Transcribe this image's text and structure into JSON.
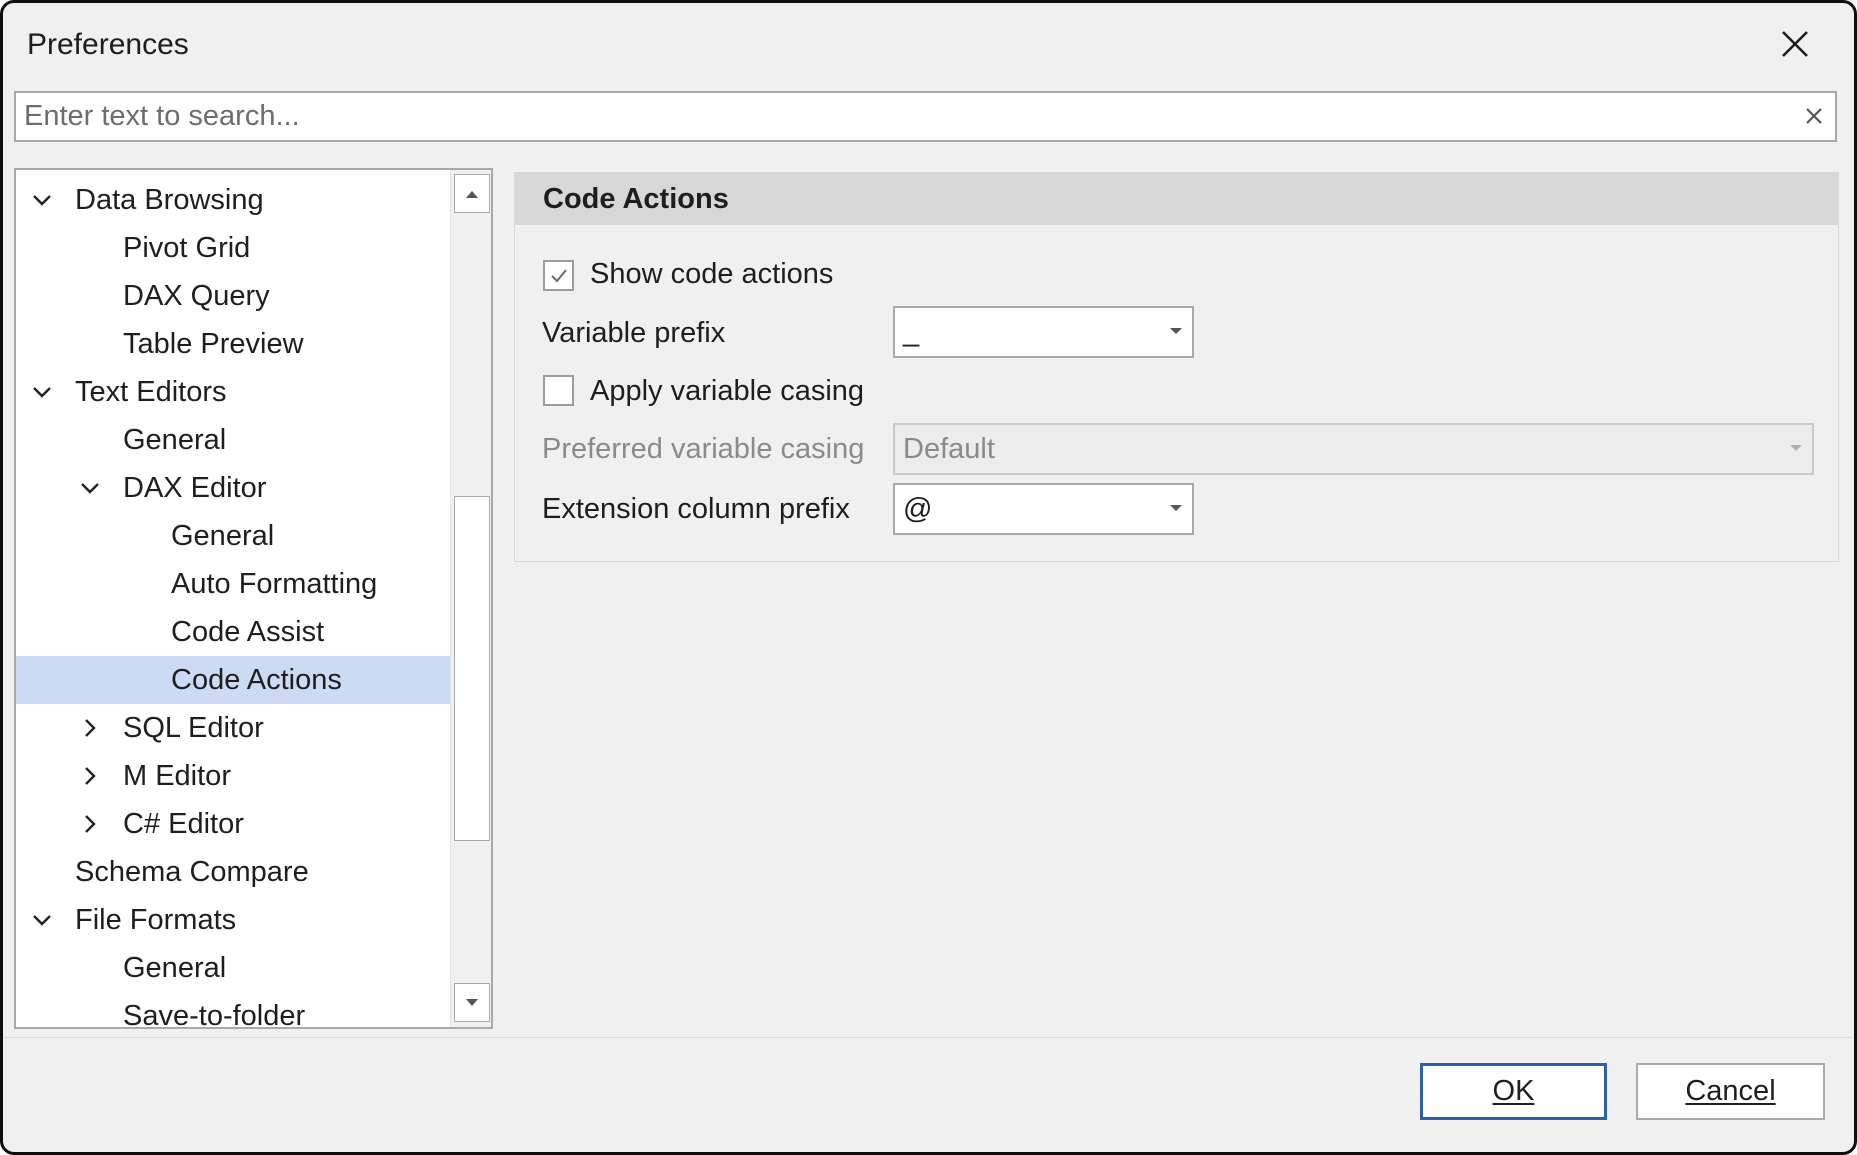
{
  "window": {
    "title": "Preferences"
  },
  "search": {
    "placeholder": "Enter text to search..."
  },
  "tree": {
    "items": [
      {
        "label": "Data Browsing",
        "expand": "expanded"
      },
      {
        "label": "Pivot Grid",
        "expand": "none"
      },
      {
        "label": "DAX Query",
        "expand": "none"
      },
      {
        "label": "Table Preview",
        "expand": "none"
      },
      {
        "label": "Text Editors",
        "expand": "expanded"
      },
      {
        "label": "General",
        "expand": "none"
      },
      {
        "label": "DAX Editor",
        "expand": "expanded"
      },
      {
        "label": "General",
        "expand": "none"
      },
      {
        "label": "Auto Formatting",
        "expand": "none"
      },
      {
        "label": "Code Assist",
        "expand": "none"
      },
      {
        "label": "Code Actions",
        "expand": "none",
        "selected": true
      },
      {
        "label": "SQL Editor",
        "expand": "collapsed"
      },
      {
        "label": "M Editor",
        "expand": "collapsed"
      },
      {
        "label": "C# Editor",
        "expand": "collapsed"
      },
      {
        "label": "Schema Compare",
        "expand": "none"
      },
      {
        "label": "File Formats",
        "expand": "expanded"
      },
      {
        "label": "General",
        "expand": "none"
      },
      {
        "label": "Save-to-folder",
        "expand": "none"
      }
    ]
  },
  "panel": {
    "header": "Code Actions",
    "show_code_actions": {
      "label": "Show code actions",
      "checked": true
    },
    "variable_prefix": {
      "label": "Variable prefix",
      "value": "_"
    },
    "apply_variable_casing": {
      "label": "Apply variable casing",
      "checked": false
    },
    "preferred_variable_casing": {
      "label": "Preferred variable casing",
      "value": "Default",
      "enabled": false
    },
    "extension_column_prefix": {
      "label": "Extension column prefix",
      "value": "@"
    }
  },
  "footer": {
    "ok_label": "OK",
    "cancel_label": "Cancel"
  },
  "colors": {
    "selection": "#ccdaf4",
    "default_button_border": "#2d5ea8",
    "panel_header": "#d7d7d7"
  }
}
